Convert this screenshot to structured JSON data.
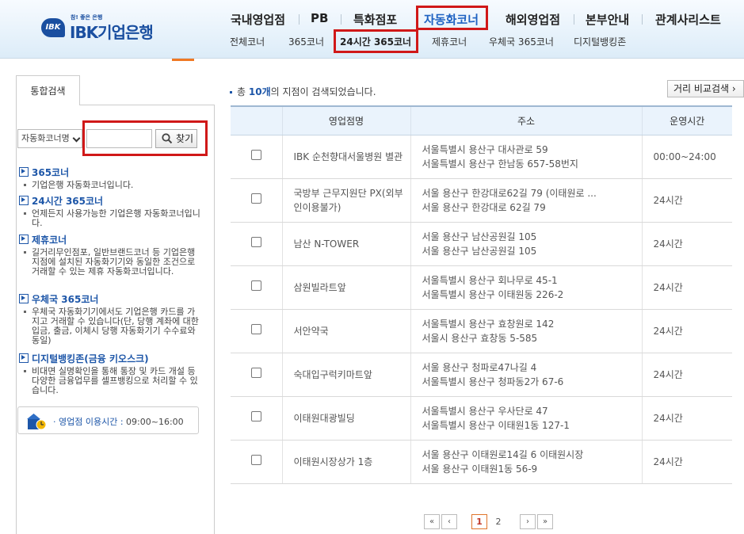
{
  "header": {
    "logo": {
      "slogan": "참! 좋은 은행",
      "mark": "IBK",
      "name": "IBK기업은행"
    },
    "gnb": [
      {
        "label": "국내영업점"
      },
      {
        "label": "PB"
      },
      {
        "label": "특화점포"
      },
      {
        "label": "자동화코너",
        "active": true
      },
      {
        "label": "해외영업점"
      },
      {
        "label": "본부안내"
      },
      {
        "label": "관계사리스트"
      }
    ],
    "subnav": [
      {
        "label": "전체코너"
      },
      {
        "label": "365코너"
      },
      {
        "label": "24시간 365코너",
        "active": true
      },
      {
        "label": "제휴코너"
      },
      {
        "label": "우체국 365코너"
      },
      {
        "label": "디지털뱅킹존"
      }
    ]
  },
  "sidebar": {
    "tab_label": "통합검색",
    "search": {
      "select_value": "자동화코너명",
      "input_value": "",
      "button_label": "찾기"
    },
    "info": [
      {
        "title": "365코너",
        "desc": "기업은행 자동화코너입니다."
      },
      {
        "title": "24시간 365코너",
        "desc": "언제든지 사용가능한 기업은행 자동화코너입니다."
      },
      {
        "title": "제휴코너",
        "desc": "길거리무인점포, 일반브랜드코너 등 기업은행 지점에 설치된 자동화기기와 동일한 조건으로 거래할 수 있는 제휴 자동화코너입니다."
      },
      {
        "title": "우체국 365코너",
        "desc": "우체국 자동화기기에서도 기업은행 카드를 가지고 거래할 수 있습니다(단, 당행 계좌에 대한 입금, 출금, 이체시 당행 자동화기기 수수료와 동일)"
      },
      {
        "title": "디지털뱅킹존(금융 키오스크)",
        "desc": "비대면 실명확인을 통해 통장 및 카드 개설 등 다양한 금융업무를 셀프뱅킹으로 처리할 수 있습니다."
      }
    ],
    "hours": {
      "label": "· 영업점 이용시간 :",
      "value": "09:00~16:00"
    }
  },
  "results": {
    "prefix": "총",
    "count": "10개",
    "suffix": "의 지점이 검색되었습니다.",
    "compare_button": "거리 비교검색 ›"
  },
  "table": {
    "headers": [
      "",
      "영업점명",
      "주소",
      "운영시간"
    ],
    "rows": [
      {
        "name": "IBK 순천향대서울병원 별관",
        "addr1": "서울특별시 용산구 대사관로 59",
        "addr2": "서울특별시 용산구 한남동 657-58번지",
        "hours": "00:00~24:00"
      },
      {
        "name": "국방부 근무지원단 PX(외부인이용불가)",
        "addr1": "서울 용산구 한강대로62길 79 (이태원로 ...",
        "addr2": "서울 용산구 한강대로 62길 79",
        "hours": "24시간"
      },
      {
        "name": "남산 N-TOWER",
        "addr1": "서울 용산구 남산공원길 105",
        "addr2": "서울 용산구 남산공원길 105",
        "hours": "24시간"
      },
      {
        "name": "삼원빌라트앞",
        "addr1": "서울특별시 용산구 회나무로 45-1",
        "addr2": "서울특별시 용산구 이태원동 226-2",
        "hours": "24시간"
      },
      {
        "name": "서안약국",
        "addr1": "서울특별시 용산구 효창원로 142",
        "addr2": "서울시 용산구 효창동 5-585",
        "hours": "24시간"
      },
      {
        "name": "숙대입구럭키마트앞",
        "addr1": "서울 용산구 청파로47나길 4",
        "addr2": "서울특별시 용산구 청파동2가 67-6",
        "hours": "24시간"
      },
      {
        "name": "이태원대광빌딩",
        "addr1": "서울특별시 용산구 우사단로 47",
        "addr2": "서울특별시 용산구 이태원1동 127-1",
        "hours": "24시간"
      },
      {
        "name": "이태원시장상가 1층",
        "addr1": "서울 용산구 이태원로14길 6 이태원시장",
        "addr2": "서울 용산구 이태원1동 56-9",
        "hours": "24시간"
      }
    ]
  },
  "pagination": {
    "first": "«",
    "prev": "‹",
    "pages": [
      "1",
      "2"
    ],
    "next": "›",
    "last": "»"
  },
  "colors": {
    "accent": "#1d56a8",
    "highlight": "#d01818",
    "header_bg": "#dcecf8"
  }
}
